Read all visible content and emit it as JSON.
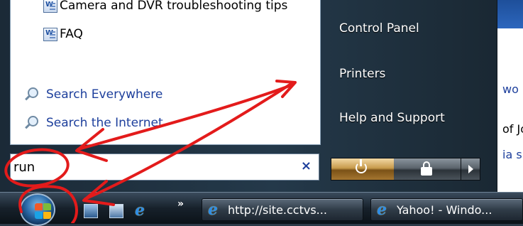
{
  "start_menu": {
    "programs": [
      {
        "label": "Camera and DVR troubleshooting tips",
        "icon": "word-document-icon"
      },
      {
        "label": "FAQ",
        "icon": "word-document-icon"
      }
    ],
    "search_links": [
      {
        "label": "Search Everywhere",
        "icon": "search-icon"
      },
      {
        "label": "Search the Internet",
        "icon": "search-icon"
      }
    ],
    "search": {
      "value": "run",
      "clear_label": "×"
    },
    "right_items": [
      "Control Panel",
      "Printers",
      "Help and Support"
    ],
    "power_buttons": {
      "power": "power-icon",
      "lock": "lock-icon",
      "more": "arrow-right-icon"
    }
  },
  "background": {
    "texts": [
      "wo",
      "of Jo",
      "ia s"
    ]
  },
  "taskbar": {
    "quick_launch": [
      "show-desktop-icon",
      "switch-windows-icon",
      "internet-explorer-icon"
    ],
    "overflow": "»",
    "ie_glyph": "e",
    "tasks": [
      {
        "label": "http://site.cctvs...",
        "icon": "internet-explorer-icon"
      },
      {
        "label": "Yahoo! - Windo...",
        "icon": "internet-explorer-icon"
      }
    ]
  },
  "colors": {
    "annotation": "#e31b1b",
    "link": "#1d3f9c",
    "menu_dark": "#1b2a37"
  }
}
